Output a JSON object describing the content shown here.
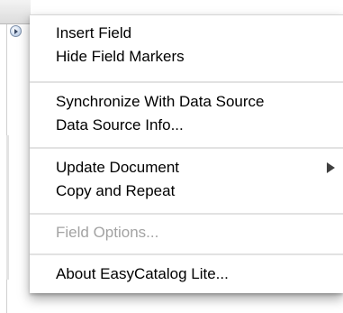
{
  "menu": {
    "items": [
      {
        "label": "Insert Field",
        "enabled": true
      },
      {
        "label": "Hide Field Markers",
        "enabled": true
      },
      {
        "label": "Synchronize With Data Source",
        "enabled": true
      },
      {
        "label": "Data Source Info...",
        "enabled": true
      },
      {
        "label": "Update Document",
        "enabled": true,
        "has_submenu": true
      },
      {
        "label": "Copy and Repeat",
        "enabled": true
      },
      {
        "label": "Field Options...",
        "enabled": false
      },
      {
        "label": "About EasyCatalog Lite...",
        "enabled": true
      }
    ]
  },
  "colors": {
    "text": "#000000",
    "disabled_text": "#a3a3a3",
    "separator": "#e2e2e2",
    "menu_background": "#ffffff"
  },
  "icons": {
    "flyout": "palette-flyout-icon",
    "submenu": "submenu-arrow-icon"
  }
}
